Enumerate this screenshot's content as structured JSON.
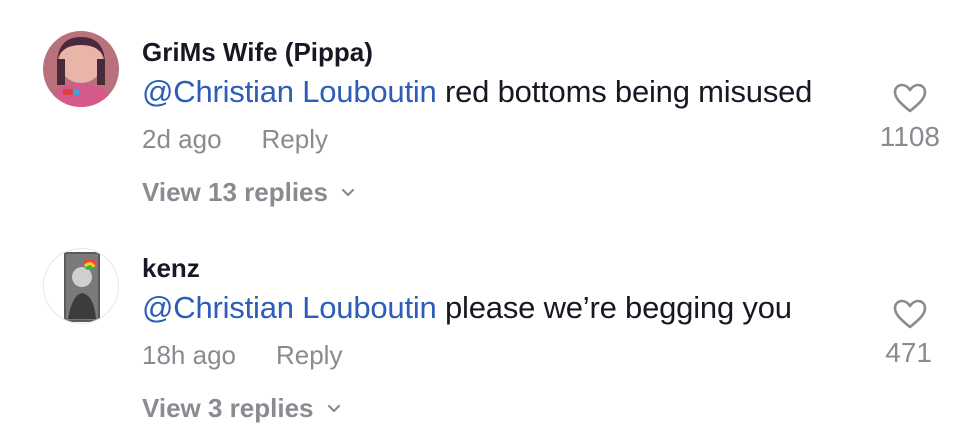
{
  "comments": [
    {
      "username": "GriMs Wife (Pippa)",
      "mention": "@Christian Louboutin",
      "text": " red bottoms being misused",
      "time": "2d ago",
      "reply_label": "Reply",
      "likes": "1108",
      "view_replies": "View 13 replies",
      "avatar_icon": "user-avatar-photo"
    },
    {
      "username": "kenz",
      "mention": "@Christian Louboutin",
      "text": " please we’re begging you",
      "time": "18h ago",
      "reply_label": "Reply",
      "likes": "471",
      "view_replies": "View 3 replies",
      "avatar_icon": "user-avatar-photo"
    }
  ],
  "colors": {
    "mention": "#2b5db9",
    "muted": "#8a8b91",
    "text": "#161823"
  },
  "icons": {
    "like": "heart-outline-icon",
    "expand": "chevron-down-icon"
  }
}
